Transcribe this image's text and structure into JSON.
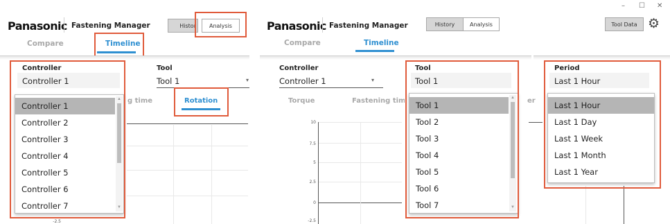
{
  "left": {
    "brand": "Panasonic",
    "app_title": "Fastening Manager",
    "history_label": "Histor",
    "analysis_label": "Analysis",
    "tabs": [
      "Compare",
      "Timeline"
    ],
    "controller": {
      "label": "Controller",
      "value": "Controller 1"
    },
    "tool": {
      "label": "Tool",
      "value": "Tool 1"
    },
    "subtabs": {
      "fastening_time": "g time",
      "rotation": "Rotation"
    },
    "controller_options": [
      "Controller 1",
      "Controller 2",
      "Controller 3",
      "Controller 4",
      "Controller 5",
      "Controller 6",
      "Controller 7"
    ],
    "selected_index": 0,
    "y_tick": "-2.5"
  },
  "right": {
    "brand": "Panasonic",
    "app_title": "Fastening Manager",
    "history_label": "History",
    "analysis_label": "Analysis",
    "tool_data_label": "Tool Data",
    "tabs": [
      "Compare",
      "Timeline"
    ],
    "controller": {
      "label": "Controller",
      "value": "Controller 1"
    },
    "tool": {
      "label": "Tool",
      "value": "Tool 1"
    },
    "period": {
      "label": "Period",
      "value": "Last 1 Hour"
    },
    "subtabs": {
      "torque": "Torque",
      "fastening_time": "Fastening time",
      "partial": "er"
    },
    "tool_options": [
      "Tool 1",
      "Tool 2",
      "Tool 3",
      "Tool 4",
      "Tool 5",
      "Tool 6",
      "Tool 7"
    ],
    "tool_selected_index": 0,
    "period_options": [
      "Last 1 Hour",
      "Last 1 Day",
      "Last 1 Week",
      "Last 1 Month",
      "Last 1 Year"
    ],
    "period_selected_index": 0,
    "y_ticks": [
      "10",
      "7.5",
      "5",
      "2.5",
      "0",
      "-2.5"
    ]
  },
  "window": {
    "minimize": "–",
    "maximize": "☐",
    "close": "✕"
  },
  "icons": {
    "gear": "gear-icon",
    "dropdown_arrow": "chevron-down-icon"
  },
  "colors": {
    "accent": "#2e8fd1",
    "highlight": "#e05a3a",
    "selected": "#b5b5b5"
  }
}
